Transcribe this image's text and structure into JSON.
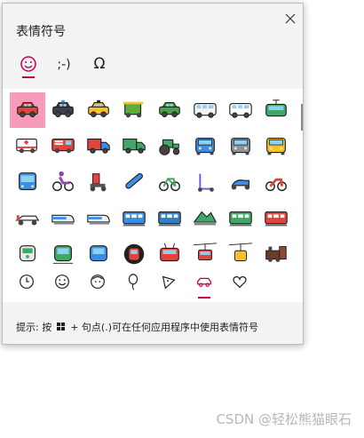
{
  "panel": {
    "title": "表情符号",
    "tabs": [
      {
        "name": "emoji",
        "label": "☺",
        "active": true
      },
      {
        "name": "kaomoji",
        "label": ";-)",
        "active": false
      },
      {
        "name": "symbols",
        "label": "Ω",
        "active": false
      }
    ],
    "emoji_rows": [
      [
        "red-car",
        "police-car",
        "taxi",
        "auto-rickshaw",
        "suv",
        "minibus",
        "van",
        "tram"
      ],
      [
        "ambulance",
        "fire-engine",
        "delivery-truck",
        "articulated-lorry",
        "tractor",
        "blue-car",
        "oncoming-car",
        "oncoming-taxi"
      ],
      [
        "bus",
        "manual-wheelchair",
        "motorized-wheelchair",
        "skateboard",
        "bicycle",
        "kick-scooter",
        "motor-scooter",
        "motorcycle"
      ],
      [
        "racing-car",
        "high-speed-train",
        "bullet-train",
        "light-rail",
        "train",
        "mountain-railway",
        "train-car",
        "railway-car"
      ],
      [
        "station",
        "metro-front",
        "monorail",
        "metro",
        "trolleybus",
        "aerial-tramway",
        "aerial-cableway",
        "steam-locomotive"
      ]
    ],
    "selected_index": 0,
    "categories": [
      {
        "name": "recent",
        "icon": "clock-icon",
        "active": false
      },
      {
        "name": "smileys",
        "icon": "smiley-icon",
        "active": false
      },
      {
        "name": "people",
        "icon": "person-icon",
        "active": false
      },
      {
        "name": "celebrations",
        "icon": "balloon-icon",
        "active": false
      },
      {
        "name": "food",
        "icon": "pizza-icon",
        "active": false
      },
      {
        "name": "transport",
        "icon": "car-icon",
        "active": true
      },
      {
        "name": "symbols",
        "icon": "heart-icon",
        "active": false
      }
    ],
    "hint_prefix": "提示: 按",
    "hint_suffix": "+ 句点(.)可在任何应用程序中使用表情符号"
  },
  "watermark": "CSDN @轻松熊猫眼石",
  "colors": {
    "accent": "#c30052",
    "selection": "#f79bbd",
    "panel_bg": "#f3f3f3"
  }
}
